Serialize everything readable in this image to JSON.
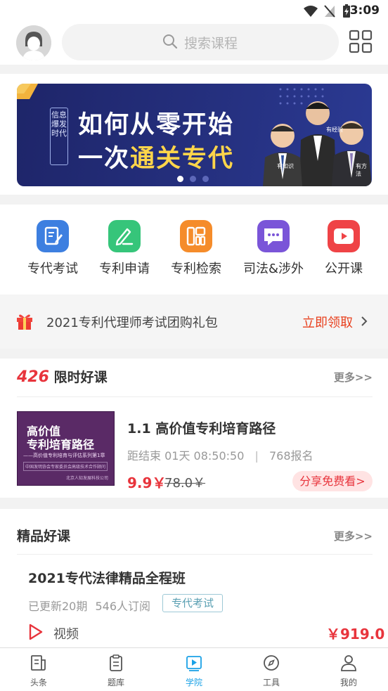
{
  "status": {
    "time": "3:09"
  },
  "search": {
    "placeholder": "搜索课程"
  },
  "banner": {
    "vertical_text": "信息爆发时代",
    "line1": "如何从零开始",
    "line2_prefix": "一次",
    "line2_highlight": "通关专代",
    "tag_a": "有知识",
    "tag_b": "有经验",
    "tag_c": "有方法"
  },
  "categories": [
    {
      "label": "专代考试",
      "color": "#3d7fe0",
      "icon": "exam-icon"
    },
    {
      "label": "专利申请",
      "color": "#36c57a",
      "icon": "edit-icon"
    },
    {
      "label": "专利检索",
      "color": "#f58c2a",
      "icon": "search-chart-icon"
    },
    {
      "label": "司法&涉外",
      "color": "#7a55d8",
      "icon": "chat-icon"
    },
    {
      "label": "公开课",
      "color": "#ef4346",
      "icon": "video-icon"
    }
  ],
  "promo": {
    "text": "2021专利代理师考试团购礼包",
    "cta": "立即领取"
  },
  "limited": {
    "count": "426",
    "title": "限时好课",
    "more": "更多>>",
    "course": {
      "cover_line1": "高价值",
      "cover_line2": "专利培育路径",
      "cover_line3": "——高价值专利培育与评估系列第1章",
      "cover_line4": "中国发明协会专家委员会高级技术合作顾问",
      "cover_line5": "北京人知发展科技公司",
      "title": "1.1 高价值专利培育路径",
      "countdown": "距结束 01天 08:50:50",
      "signups": "768报名",
      "price": "9.9￥",
      "old_price": "78.0￥",
      "share": "分享免费看>"
    }
  },
  "premium": {
    "title": "精品好课",
    "more": "更多>>",
    "course": {
      "title": "2021专代法律精品全程班",
      "updates": "已更新20期",
      "subscribers": "546人订阅",
      "tag": "专代考试",
      "media": "视频",
      "price": "￥919.0"
    }
  },
  "tabs": [
    {
      "label": "头条",
      "icon": "news-icon"
    },
    {
      "label": "题库",
      "icon": "question-bank-icon"
    },
    {
      "label": "学院",
      "icon": "academy-icon",
      "active": true
    },
    {
      "label": "工具",
      "icon": "compass-icon"
    },
    {
      "label": "我的",
      "icon": "profile-icon"
    }
  ],
  "colors": {
    "accent": "#e8343c",
    "active_tab": "#1aa1e6"
  }
}
